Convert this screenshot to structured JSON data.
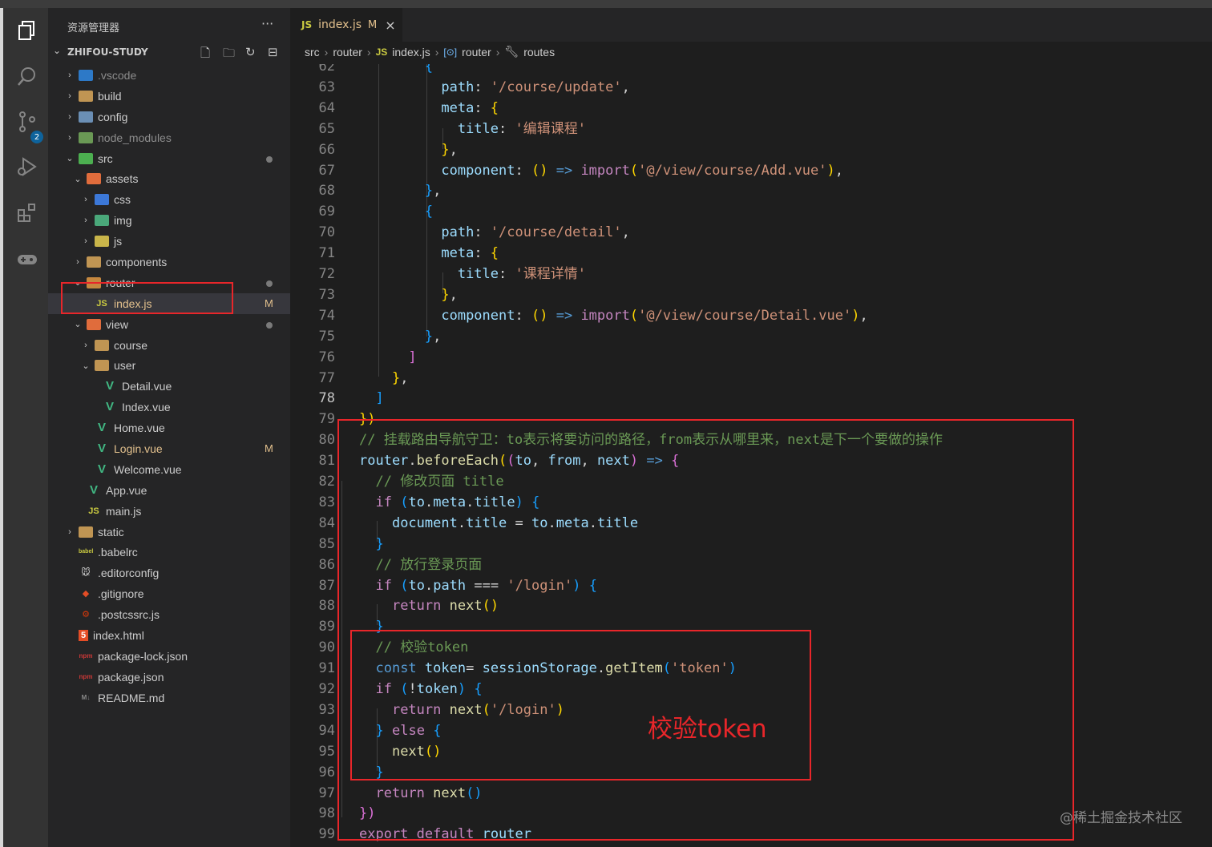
{
  "explorer": {
    "title": "资源管理器",
    "more": "···",
    "project": "ZHIFOU-STUDY",
    "tree": [
      {
        "label": ".vscode",
        "depth": 0,
        "type": "folder",
        "cls": "vs",
        "open": false
      },
      {
        "label": "build",
        "depth": 0,
        "type": "folder",
        "cls": "",
        "open": false
      },
      {
        "label": "config",
        "depth": 0,
        "type": "folder",
        "cls": "cfg",
        "open": false
      },
      {
        "label": "node_modules",
        "depth": 0,
        "type": "folder",
        "cls": "nm",
        "open": false
      },
      {
        "label": "src",
        "depth": 0,
        "type": "folder",
        "cls": "src",
        "open": true,
        "dot": true
      },
      {
        "label": "assets",
        "depth": 1,
        "type": "folder",
        "cls": "red",
        "open": true
      },
      {
        "label": "css",
        "depth": 2,
        "type": "folder",
        "cls": "css",
        "open": false
      },
      {
        "label": "img",
        "depth": 2,
        "type": "folder",
        "cls": "img",
        "open": false
      },
      {
        "label": "js",
        "depth": 2,
        "type": "folder",
        "cls": "js",
        "open": false
      },
      {
        "label": "components",
        "depth": 1,
        "type": "folder",
        "cls": "",
        "open": false
      },
      {
        "label": "router",
        "depth": 1,
        "type": "folder",
        "cls": "router",
        "open": true,
        "dot": true
      },
      {
        "label": "index.js",
        "depth": 2,
        "type": "js",
        "mark": "M",
        "selected": true
      },
      {
        "label": "view",
        "depth": 1,
        "type": "folder",
        "cls": "red",
        "open": true,
        "dot": true
      },
      {
        "label": "course",
        "depth": 2,
        "type": "folder",
        "cls": "",
        "open": false
      },
      {
        "label": "user",
        "depth": 2,
        "type": "folder",
        "cls": "",
        "open": true
      },
      {
        "label": "Detail.vue",
        "depth": 3,
        "type": "vue"
      },
      {
        "label": "Index.vue",
        "depth": 3,
        "type": "vue"
      },
      {
        "label": "Home.vue",
        "depth": 2,
        "type": "vue"
      },
      {
        "label": "Login.vue",
        "depth": 2,
        "type": "vue",
        "mark": "M"
      },
      {
        "label": "Welcome.vue",
        "depth": 2,
        "type": "vue"
      },
      {
        "label": "App.vue",
        "depth": 1,
        "type": "vue"
      },
      {
        "label": "main.js",
        "depth": 1,
        "type": "js"
      },
      {
        "label": "static",
        "depth": 0,
        "type": "folder",
        "cls": "",
        "open": false
      },
      {
        "label": ".babelrc",
        "depth": 0,
        "type": "babel"
      },
      {
        "label": ".editorconfig",
        "depth": 0,
        "type": "editorconfig"
      },
      {
        "label": ".gitignore",
        "depth": 0,
        "type": "git"
      },
      {
        "label": ".postcssrc.js",
        "depth": 0,
        "type": "postcss"
      },
      {
        "label": "index.html",
        "depth": 0,
        "type": "html"
      },
      {
        "label": "package-lock.json",
        "depth": 0,
        "type": "npm"
      },
      {
        "label": "package.json",
        "depth": 0,
        "type": "npm"
      },
      {
        "label": "README.md",
        "depth": 0,
        "type": "md"
      }
    ]
  },
  "activity_badge": "2",
  "tab": {
    "icon": "JS",
    "name": "index.js",
    "modified": "M",
    "close": "×"
  },
  "breadcrumb": [
    "src",
    "router",
    "index.js",
    "router",
    "routes"
  ],
  "code_lines": [
    {
      "n": "62",
      "html": "        <span class='b3'>{</span>"
    },
    {
      "n": "63",
      "html": "          <span class='prop'>path</span>: <span class='str'>'/course/update'</span>,"
    },
    {
      "n": "64",
      "html": "          <span class='prop'>meta</span>: <span class='b1'>{</span>"
    },
    {
      "n": "65",
      "html": "            <span class='prop'>title</span>: <span class='str'>'编辑课程'</span>"
    },
    {
      "n": "66",
      "html": "          <span class='b1'>}</span>,"
    },
    {
      "n": "67",
      "html": "          <span class='prop'>component</span>: <span class='b1'>()</span> <span class='kw'>=&gt;</span> <span class='kw2'>import</span><span class='b1'>(</span><span class='str'>'@/view/course/Add.vue'</span><span class='b1'>)</span>,"
    },
    {
      "n": "68",
      "html": "        <span class='b3'>}</span>,"
    },
    {
      "n": "69",
      "html": "        <span class='b3'>{</span>"
    },
    {
      "n": "70",
      "html": "          <span class='prop'>path</span>: <span class='str'>'/course/detail'</span>,"
    },
    {
      "n": "71",
      "html": "          <span class='prop'>meta</span>: <span class='b1'>{</span>"
    },
    {
      "n": "72",
      "html": "            <span class='prop'>title</span>: <span class='str'>'课程详情'</span>"
    },
    {
      "n": "73",
      "html": "          <span class='b1'>}</span>,"
    },
    {
      "n": "74",
      "html": "          <span class='prop'>component</span>: <span class='b1'>()</span> <span class='kw'>=&gt;</span> <span class='kw2'>import</span><span class='b1'>(</span><span class='str'>'@/view/course/Detail.vue'</span><span class='b1'>)</span>,"
    },
    {
      "n": "75",
      "html": "        <span class='b3'>}</span>,"
    },
    {
      "n": "76",
      "html": "      <span class='b2'>]</span>"
    },
    {
      "n": "77",
      "html": "    <span class='b1'>}</span>,"
    },
    {
      "n": "78",
      "html": "  <span class='b3'>]</span>",
      "current": true
    },
    {
      "n": "79",
      "html": "<span class='b1'>})</span>"
    },
    {
      "n": "80",
      "html": "<span class='cm'>// 挂载路由导航守卫：to表示将要访问的路径，from表示从哪里来，next是下一个要做的操作</span>"
    },
    {
      "n": "81",
      "html": "<span class='vr'>router</span>.<span class='fn'>beforeEach</span><span class='b1'>(</span><span class='b2'>(</span><span class='vr'>to</span>, <span class='vr'>from</span>, <span class='vr'>next</span><span class='b2'>)</span> <span class='kw'>=&gt;</span> <span class='b2'>{</span>"
    },
    {
      "n": "82",
      "html": "  <span class='cm'>// 修改页面 title</span>"
    },
    {
      "n": "83",
      "html": "  <span class='kw2'>if</span> <span class='b3'>(</span><span class='vr'>to</span>.<span class='vr'>meta</span>.<span class='vr'>title</span><span class='b3'>)</span> <span class='b3'>{</span>"
    },
    {
      "n": "84",
      "html": "    <span class='vr'>document</span>.<span class='vr'>title</span> = <span class='vr'>to</span>.<span class='vr'>meta</span>.<span class='vr'>title</span>"
    },
    {
      "n": "85",
      "html": "  <span class='b3'>}</span>"
    },
    {
      "n": "86",
      "html": "  <span class='cm'>// 放行登录页面</span>"
    },
    {
      "n": "87",
      "html": "  <span class='kw2'>if</span> <span class='b3'>(</span><span class='vr'>to</span>.<span class='vr'>path</span> === <span class='str'>'/login'</span><span class='b3'>)</span> <span class='b3'>{</span>"
    },
    {
      "n": "88",
      "html": "    <span class='kw2'>return</span> <span class='fn'>next</span><span class='b1'>()</span>"
    },
    {
      "n": "89",
      "html": "  <span class='b3'>}</span>"
    },
    {
      "n": "90",
      "html": "  <span class='cm'>// 校验token</span>"
    },
    {
      "n": "91",
      "html": "  <span class='kw'>const</span> <span class='vr'>token</span>= <span class='vr'>sessionStorage</span>.<span class='fn'>getItem</span><span class='b3'>(</span><span class='str'>'token'</span><span class='b3'>)</span>"
    },
    {
      "n": "92",
      "html": "  <span class='kw2'>if</span> <span class='b3'>(</span>!<span class='vr'>token</span><span class='b3'>)</span> <span class='b3'>{</span>"
    },
    {
      "n": "93",
      "html": "    <span class='kw2'>return</span> <span class='fn'>next</span><span class='b1'>(</span><span class='str'>'/login'</span><span class='b1'>)</span>"
    },
    {
      "n": "94",
      "html": "  <span class='b3'>}</span> <span class='kw2'>else</span> <span class='b3'>{</span>"
    },
    {
      "n": "95",
      "html": "    <span class='fn'>next</span><span class='b1'>()</span>"
    },
    {
      "n": "96",
      "html": "  <span class='b3'>}</span>"
    },
    {
      "n": "97",
      "html": "  <span class='kw2'>return</span> <span class='fn'>next</span><span class='b3'>()</span>"
    },
    {
      "n": "98",
      "html": "<span class='b2'>})</span>"
    },
    {
      "n": "99",
      "html": "<span class='kw2'>export</span> <span class='kw2'>default</span> <span class='vr'>router</span>"
    }
  ],
  "annotation": "校验token",
  "watermark": "@稀土掘金技术社区",
  "colors": {
    "highlight_box": "#e8262a",
    "accent": "#0e639c"
  }
}
